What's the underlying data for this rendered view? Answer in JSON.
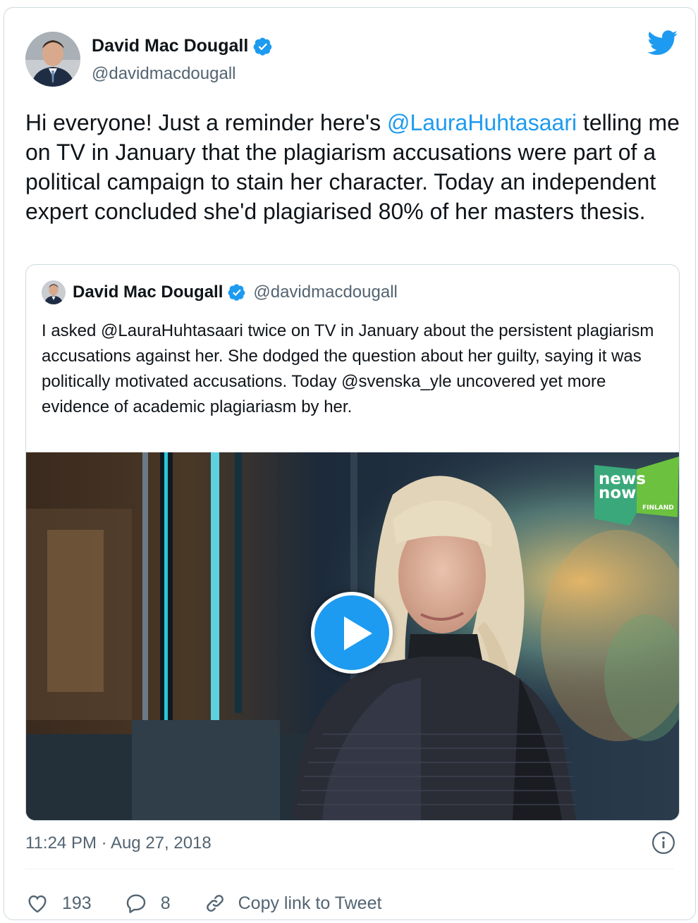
{
  "author": {
    "name": "David Mac Dougall",
    "handle": "@davidmacdougall",
    "avatar_icon": "person-avatar"
  },
  "tweet": {
    "text_before": "Hi everyone! Just a reminder here's ",
    "mention": "@LauraHuhtasaari",
    "text_after": " telling me on TV in January that the plagiarism accusations were part of a political campaign to stain her character. Today an independent expert concluded she'd plagiarised 80% of her masters thesis.",
    "timestamp": "11:24 PM · Aug 27, 2018"
  },
  "quoted_tweet": {
    "name": "David Mac Dougall",
    "handle": "@davidmacdougall",
    "text": "I asked @LauraHuhtasaari twice on TV in January about the persistent plagiarism accusations against her. She dodged the question about her guilty, saying it was politically motivated accusations. Today @svenska_yle uncovered yet more evidence of academic plagiariasm by her."
  },
  "media": {
    "logo_line1": "news",
    "logo_line2": "now",
    "logo_sub": "FINLAND",
    "play_icon": "play-icon"
  },
  "actions": {
    "likes": "193",
    "replies": "8",
    "copy_link": "Copy link to Tweet"
  },
  "colors": {
    "accent": "#1d9bf0",
    "text": "#0f1419",
    "muted": "#536471",
    "border": "#cfd9de"
  }
}
